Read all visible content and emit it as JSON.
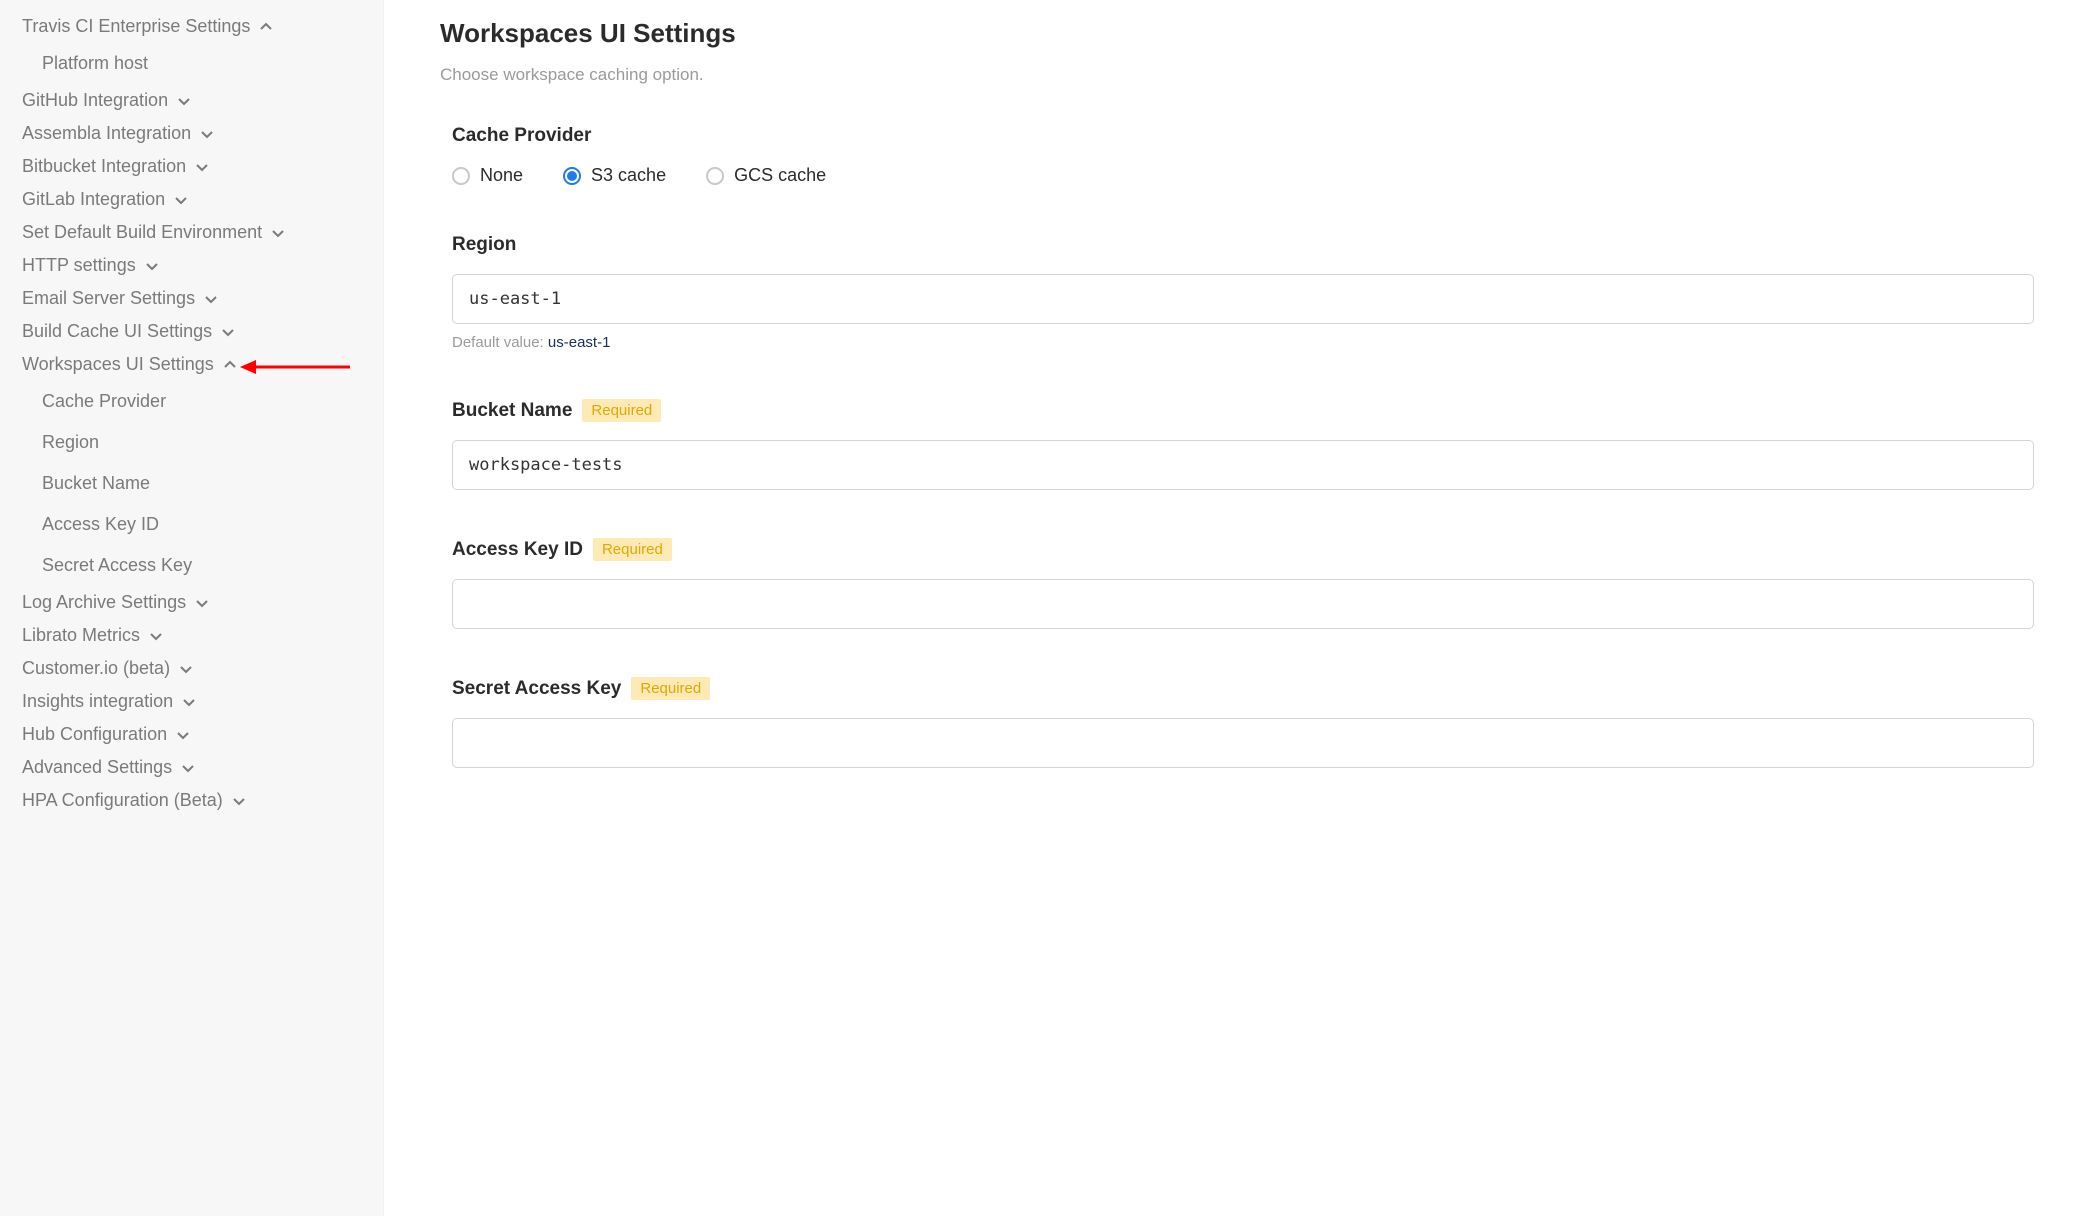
{
  "sidebar": {
    "items": [
      {
        "label": "Travis CI Enterprise Settings",
        "expanded": true,
        "children": [
          {
            "label": "Platform host"
          }
        ]
      },
      {
        "label": "GitHub Integration",
        "expanded": false
      },
      {
        "label": "Assembla Integration",
        "expanded": false
      },
      {
        "label": "Bitbucket Integration",
        "expanded": false
      },
      {
        "label": "GitLab Integration",
        "expanded": false
      },
      {
        "label": "Set Default Build Environment",
        "expanded": false
      },
      {
        "label": "HTTP settings",
        "expanded": false
      },
      {
        "label": "Email Server Settings",
        "expanded": false
      },
      {
        "label": "Build Cache UI Settings",
        "expanded": false
      },
      {
        "label": "Workspaces UI Settings",
        "expanded": true,
        "highlighted": true,
        "children": [
          {
            "label": "Cache Provider"
          },
          {
            "label": "Region"
          },
          {
            "label": "Bucket Name"
          },
          {
            "label": "Access Key ID"
          },
          {
            "label": "Secret Access Key"
          }
        ]
      },
      {
        "label": "Log Archive Settings",
        "expanded": false
      },
      {
        "label": "Librato Metrics",
        "expanded": false
      },
      {
        "label": "Customer.io (beta)",
        "expanded": false
      },
      {
        "label": "Insights integration",
        "expanded": false
      },
      {
        "label": "Hub Configuration",
        "expanded": false
      },
      {
        "label": "Advanced Settings",
        "expanded": false
      },
      {
        "label": "HPA Configuration (Beta)",
        "expanded": false
      }
    ]
  },
  "main": {
    "title": "Workspaces UI Settings",
    "subtitle": "Choose workspace caching option.",
    "cache_provider": {
      "label": "Cache Provider",
      "options": [
        {
          "label": "None",
          "selected": false
        },
        {
          "label": "S3 cache",
          "selected": true
        },
        {
          "label": "GCS cache",
          "selected": false
        }
      ]
    },
    "region": {
      "label": "Region",
      "value": "us-east-1",
      "hint_prefix": "Default value: ",
      "hint_value": "us-east-1"
    },
    "bucket_name": {
      "label": "Bucket Name",
      "required_label": "Required",
      "value": "workspace-tests"
    },
    "access_key_id": {
      "label": "Access Key ID",
      "required_label": "Required",
      "value": ""
    },
    "secret_access_key": {
      "label": "Secret Access Key",
      "required_label": "Required",
      "value": ""
    }
  }
}
